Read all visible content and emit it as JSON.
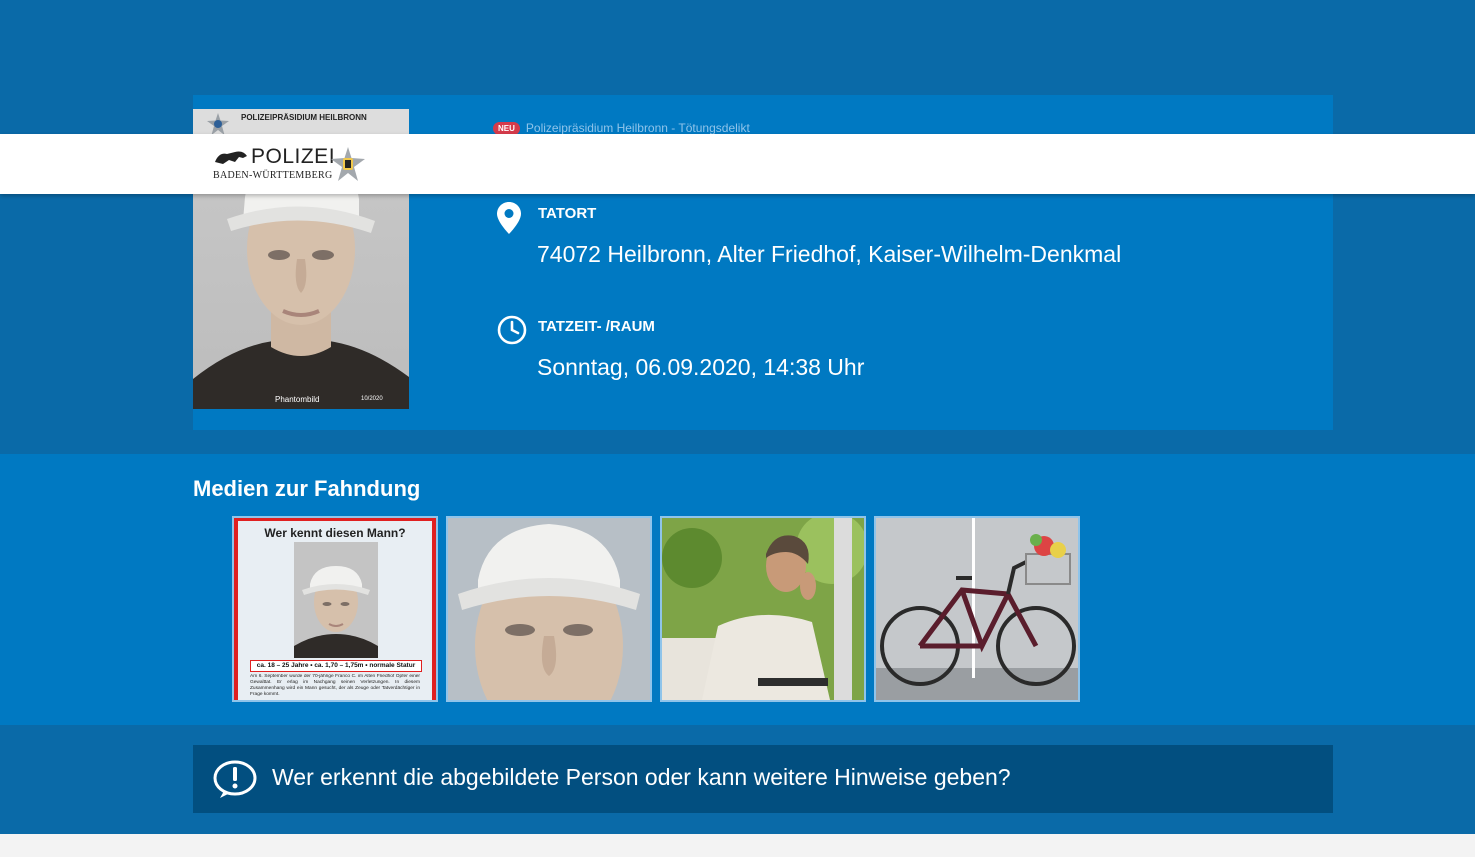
{
  "breadcrumb": {
    "badge": "NEU",
    "text": "Polizeipräsidium Heilbronn - Tötungsdelikt"
  },
  "header": {
    "logo_word": "POLIZEI",
    "logo_sub": "BADEN-WÜRTTEMBERG"
  },
  "portrait": {
    "header_text": "POLIZEIPRÄSIDIUM HEILBRONN",
    "caption": "Phantombild",
    "number": "10/2020"
  },
  "tatort": {
    "label": "TATORT",
    "value": "74072 Heilbronn, Alter Friedhof, Kaiser-Wilhelm-Denkmal",
    "icon": "map-pin-icon"
  },
  "tatzeit": {
    "label": "TATZEIT- /RAUM",
    "value": "Sonntag, 06.09.2020, 14:38 Uhr",
    "icon": "clock-icon"
  },
  "media": {
    "title": "Medien zur Fahndung",
    "poster": {
      "headline": "Wer kennt diesen Mann?",
      "facts": "ca. 18 – 25 Jahre • ca. 1,70 – 1,75m • normale Statur",
      "body": "Am 6. September wurde der 70-jährige Franco C. im Alten Friedhof Opfer einer Gewalttat. Er erlag im Nachgang seinen Verletzungen. In diesem Zusammenhang wird ein Mann gesucht, der als Zeuge oder Tatverdächtiger in Frage kommt."
    }
  },
  "cta": {
    "text": "Wer erkennt die abgebildete Person oder kann weitere Hinweise geben?",
    "icon": "exclamation-circle-icon"
  },
  "colors": {
    "primary": "#0079c2",
    "dark": "#0a6aa8",
    "cta": "#024f80",
    "badge": "#d43b4b"
  }
}
